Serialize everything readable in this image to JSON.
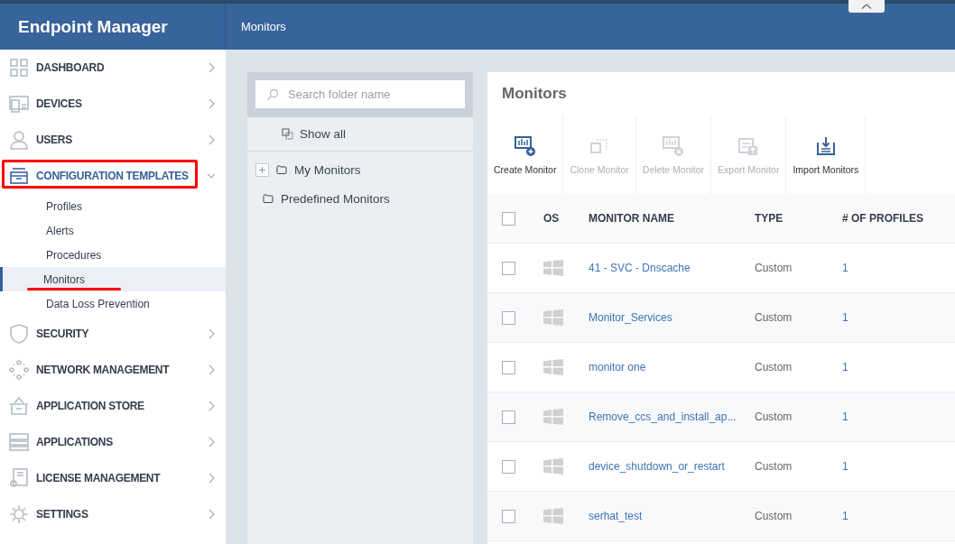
{
  "app": {
    "title": "Endpoint Manager"
  },
  "header": {
    "breadcrumb": "Monitors"
  },
  "sidebar": {
    "items": [
      {
        "label": "DASHBOARD",
        "expanded": false,
        "highlighted": false
      },
      {
        "label": "DEVICES",
        "expanded": false,
        "highlighted": false
      },
      {
        "label": "USERS",
        "expanded": false,
        "highlighted": false
      },
      {
        "label": "CONFIGURATION TEMPLATES",
        "expanded": true,
        "highlighted": true,
        "children": [
          {
            "label": "Profiles",
            "selected": false,
            "underlined": false
          },
          {
            "label": "Alerts",
            "selected": false,
            "underlined": false
          },
          {
            "label": "Procedures",
            "selected": false,
            "underlined": false
          },
          {
            "label": "Monitors",
            "selected": true,
            "underlined": true
          },
          {
            "label": "Data Loss Prevention",
            "selected": false,
            "underlined": false
          }
        ]
      },
      {
        "label": "SECURITY",
        "expanded": false,
        "highlighted": false
      },
      {
        "label": "NETWORK MANAGEMENT",
        "expanded": false,
        "highlighted": false
      },
      {
        "label": "APPLICATION STORE",
        "expanded": false,
        "highlighted": false
      },
      {
        "label": "APPLICATIONS",
        "expanded": false,
        "highlighted": false
      },
      {
        "label": "LICENSE MANAGEMENT",
        "expanded": false,
        "highlighted": false
      },
      {
        "label": "SETTINGS",
        "expanded": false,
        "highlighted": false
      }
    ]
  },
  "folders": {
    "search": {
      "placeholder": "Search folder name"
    },
    "show_all": "Show all",
    "tree": [
      {
        "label": "My Monitors",
        "expandable": true
      },
      {
        "label": "Predefined Monitors",
        "expandable": false
      }
    ]
  },
  "panel": {
    "title": "Monitors",
    "toolbar": [
      {
        "label": "Create Monitor",
        "disabled": false
      },
      {
        "label": "Clone Monitor",
        "disabled": true
      },
      {
        "label": "Delete Monitor",
        "disabled": true
      },
      {
        "label": "Export Monitor",
        "disabled": true
      },
      {
        "label": "Import Monitors",
        "disabled": false
      }
    ],
    "table": {
      "select_all": false,
      "columns": [
        "OS",
        "MONITOR NAME",
        "TYPE",
        "# OF PROFILES"
      ],
      "rows": [
        {
          "checked": false,
          "name": "41 - SVC - Dnscache",
          "type": "Custom",
          "profiles": "1"
        },
        {
          "checked": false,
          "name": "Monitor_Services",
          "type": "Custom",
          "profiles": "1"
        },
        {
          "checked": false,
          "name": "monitor one",
          "type": "Custom",
          "profiles": "1"
        },
        {
          "checked": false,
          "name": "Remove_ccs_and_install_ap...",
          "type": "Custom",
          "profiles": "1"
        },
        {
          "checked": false,
          "name": "device_shutdown_or_restart",
          "type": "Custom",
          "profiles": "1"
        },
        {
          "checked": false,
          "name": "serhat_test",
          "type": "Custom",
          "profiles": "1"
        }
      ]
    }
  }
}
